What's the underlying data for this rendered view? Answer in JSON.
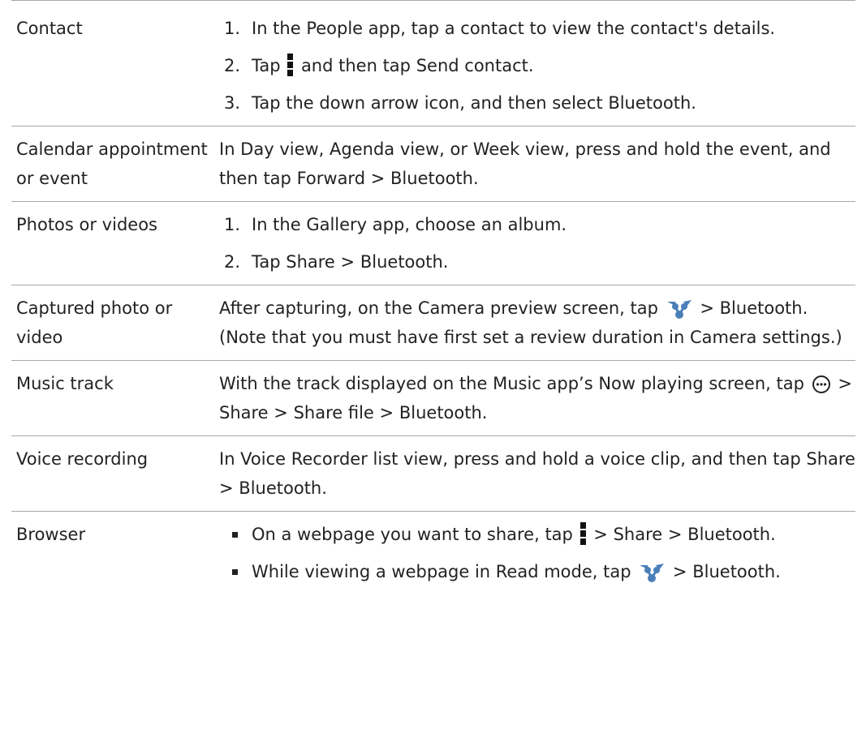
{
  "rows": [
    {
      "label": "Contact",
      "steps": [
        {
          "num": "1.",
          "text": "In the People app, tap a contact to view the contact's details."
        },
        {
          "num": "2.",
          "pre": "Tap",
          "post": "and then tap",
          "bold": "Send contact",
          "end": "."
        },
        {
          "num": "3.",
          "text": "Tap the down arrow icon, and then select",
          "bold": "Bluetooth",
          "end": "."
        }
      ]
    },
    {
      "label": "Calendar appointment or event",
      "text": "In Day view, Agenda view, or Week view, press and hold the event, and then tap",
      "path": [
        "Forward",
        ">",
        "Bluetooth"
      ],
      "end": "."
    },
    {
      "label": "Photos or videos",
      "steps": [
        {
          "num": "1.",
          "text": "In the Gallery app, choose an album."
        },
        {
          "num": "2.",
          "pre": "Tap",
          "path": [
            "Share",
            ">",
            "Bluetooth"
          ],
          "end": "."
        }
      ]
    },
    {
      "label": "Captured photo or video",
      "text": "After capturing, on the Camera preview screen, tap",
      "after": ">",
      "bold": "Bluetooth",
      "note": ". (Note that you must have first set a review duration in Camera settings.)"
    },
    {
      "label": "Music track",
      "text": "With the track displayed on the Music app’s Now playing screen, tap",
      "path": [
        ">",
        "Share",
        ">",
        "Share file",
        ">",
        "Bluetooth"
      ],
      "end": "."
    },
    {
      "label": "Voice recording",
      "text": "In Voice Recorder list view, press and hold a voice clip, and then tap",
      "path": [
        "Share",
        ">",
        "Bluetooth"
      ],
      "end": "."
    },
    {
      "label": "Browser",
      "bullets": [
        {
          "text": "On a webpage you want to share, tap",
          "path": [
            ">",
            "Share",
            ">"
          ],
          "bold2": "Bluetooth",
          "end": "."
        },
        {
          "text": "While viewing a webpage in Read mode, tap",
          "after": ">",
          "bold2": "Bluetooth",
          "end": "."
        }
      ]
    }
  ],
  "icons": {
    "menu": "menu-icon",
    "share": "share-icon",
    "more": "more-icon"
  },
  "colors": {
    "rule": "#a8a8a8",
    "share_icon": "#4a7fb8",
    "text": "#222222"
  }
}
